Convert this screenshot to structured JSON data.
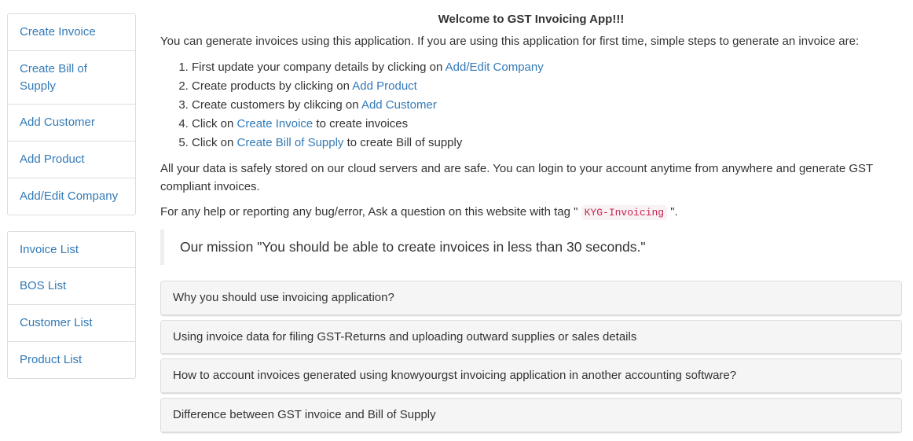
{
  "sidebar": {
    "groups": [
      {
        "name": "primary-actions",
        "items": [
          {
            "label": "Create Invoice",
            "key": "create-invoice"
          },
          {
            "label": "Create Bill of Supply",
            "key": "create-bill-of-supply"
          },
          {
            "label": "Add Customer",
            "key": "add-customer"
          },
          {
            "label": "Add Product",
            "key": "add-product"
          },
          {
            "label": "Add/Edit Company",
            "key": "add-edit-company"
          }
        ]
      },
      {
        "name": "lists",
        "items": [
          {
            "label": "Invoice List",
            "key": "invoice-list"
          },
          {
            "label": "BOS List",
            "key": "bos-list"
          },
          {
            "label": "Customer List",
            "key": "customer-list"
          },
          {
            "label": "Product List",
            "key": "product-list"
          }
        ]
      }
    ]
  },
  "main": {
    "heading": "Welcome to GST Invoicing App!!!",
    "intro": "You can generate invoices using this application. If you are using this application for first time, simple steps to generate an invoice are:",
    "steps": [
      {
        "before": "First update your company details by clicking on ",
        "link": "Add/Edit Company",
        "after": ""
      },
      {
        "before": "Create products by clicking on ",
        "link": "Add Product",
        "after": ""
      },
      {
        "before": "Create customers by clikcing on ",
        "link": "Add Customer",
        "after": ""
      },
      {
        "before": "Click on ",
        "link": "Create Invoice",
        "after": " to create invoices"
      },
      {
        "before": "Click on ",
        "link": "Create Bill of Supply",
        "after": " to create Bill of supply"
      }
    ],
    "cloud_note": "All your data is safely stored on our cloud servers and are safe. You can login to your account anytime from anywhere and generate GST compliant invoices.",
    "help_note": {
      "before": "For any help or reporting any bug/error, Ask a question on this website with tag \" ",
      "tag": "KYG-Invoicing",
      "after": " \"."
    },
    "mission": "Our mission \"You should be able to create invoices in less than 30 seconds.\"",
    "panels": [
      {
        "title": "Why you should use invoicing application?",
        "key": "why-use-invoicing"
      },
      {
        "title": "Using invoice data for filing GST-Returns and uploading outward supplies or sales details",
        "key": "using-invoice-data"
      },
      {
        "title": "How to account invoices generated using knowyourgst invoicing application in another accounting software?",
        "key": "how-to-account-invoices"
      },
      {
        "title": "Difference between GST invoice and Bill of Supply",
        "key": "difference-invoice-bos"
      }
    ]
  },
  "colors": {
    "link": "#337ab7",
    "text": "#333333",
    "panel_heading_bg": "#f5f5f5",
    "border": "#dddddd",
    "code_text": "#c7254e",
    "code_bg": "#f9f2f4",
    "blockquote_border": "#eeeeee"
  }
}
